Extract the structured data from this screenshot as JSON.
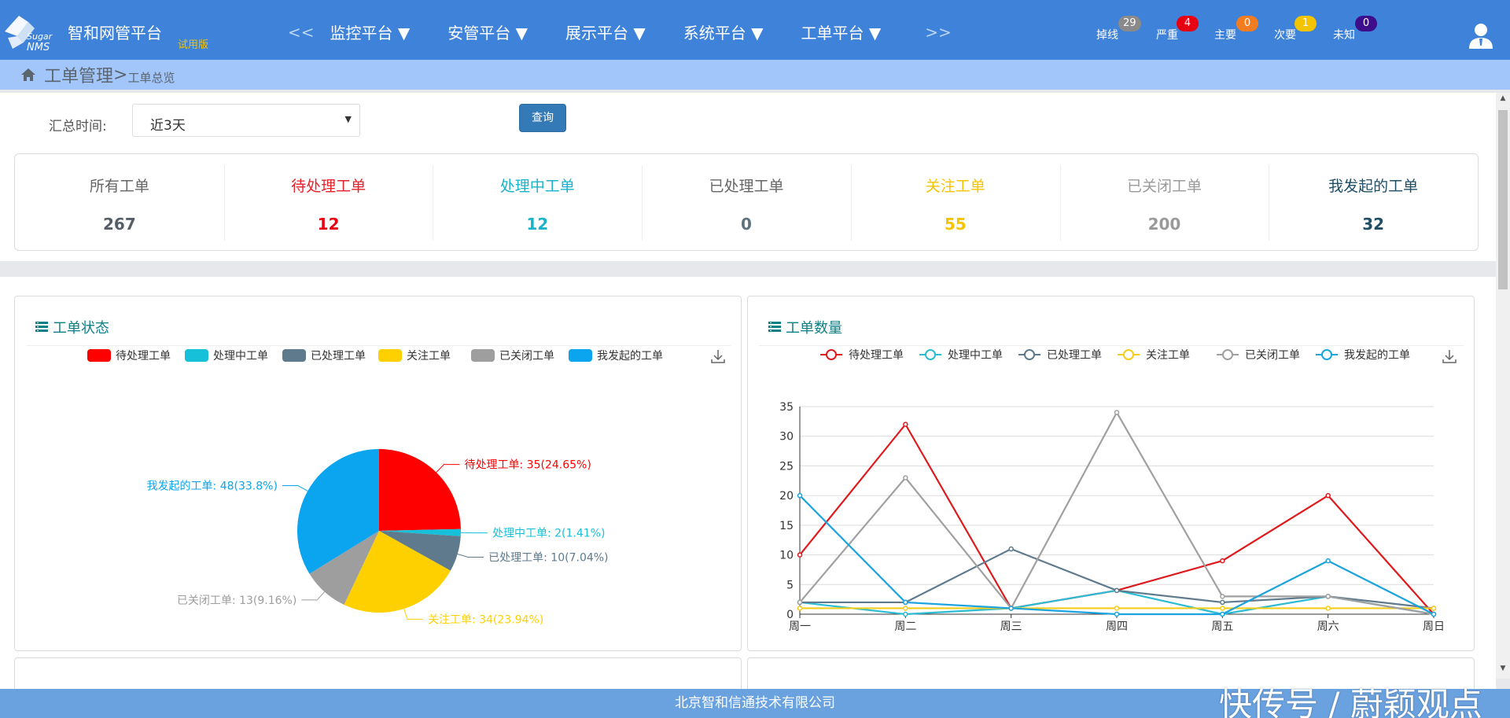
{
  "header": {
    "logo_text_1": "Sugar",
    "logo_text_2": "NMS",
    "app_title": "智和网管平台",
    "trial_badge": "试用版",
    "nav_prev": "<<",
    "nav_next": ">>",
    "nav_items": [
      "监控平台 ▼",
      "安管平台 ▼",
      "展示平台 ▼",
      "系统平台 ▼",
      "工单平台 ▼"
    ],
    "alarms": [
      {
        "label": "掉线",
        "count": "29",
        "color": "#8a8a8a"
      },
      {
        "label": "严重",
        "count": "4",
        "color": "#e60012"
      },
      {
        "label": "主要",
        "count": "0",
        "color": "#f47c20"
      },
      {
        "label": "次要",
        "count": "1",
        "color": "#f5c400"
      },
      {
        "label": "未知",
        "count": "0",
        "color": "#3d0d8c"
      }
    ],
    "user_icon": "user-icon"
  },
  "breadcrumb": {
    "home_icon": "home-icon",
    "main": "工单管理",
    "sep": ">",
    "sub": "工单总览"
  },
  "filter": {
    "label": "汇总时间:",
    "selected": "近3天",
    "query_button": "查询"
  },
  "stats": [
    {
      "label": "所有工单",
      "value": "267",
      "label_color": "#666666",
      "value_color": "#555e66"
    },
    {
      "label": "待处理工单",
      "value": "12",
      "label_color": "#e62129",
      "value_color": "#e60012"
    },
    {
      "label": "处理中工单",
      "value": "12",
      "label_color": "#19b4cc",
      "value_color": "#19b4cc"
    },
    {
      "label": "已处理工单",
      "value": "0",
      "label_color": "#666666",
      "value_color": "#5f7280"
    },
    {
      "label": "关注工单",
      "value": "55",
      "label_color": "#f5c400",
      "value_color": "#f5c400"
    },
    {
      "label": "已关闭工单",
      "value": "200",
      "label_color": "#9a9a9a",
      "value_color": "#9a9a9a"
    },
    {
      "label": "我发起的工单",
      "value": "32",
      "label_color": "#1f4e66",
      "value_color": "#1f4e66"
    }
  ],
  "cards": {
    "status_title": "工单状态",
    "count_title": "工单数量",
    "title_icon": "list-icon",
    "download_icon": "download-icon"
  },
  "chart_data": [
    {
      "type": "pie",
      "legend": [
        "待处理工单",
        "处理中工单",
        "已处理工单",
        "关注工单",
        "已关闭工单",
        "我发起的工单"
      ],
      "colors": [
        "#ff0000",
        "#16c0d8",
        "#5f7a8c",
        "#ffd000",
        "#9e9e9e",
        "#0aa5ee"
      ],
      "values": [
        35,
        2,
        10,
        34,
        13,
        48
      ],
      "labels": [
        "待处理工单: 35(24.65%)",
        "处理中工单: 2(1.41%)",
        "已处理工单: 10(7.04%)",
        "关注工单: 34(23.94%)",
        "已关闭工单: 13(9.16%)",
        "我发起的工单: 48(33.8%)"
      ],
      "legend_position": "top"
    },
    {
      "type": "line",
      "categories": [
        "周一",
        "周二",
        "周三",
        "周四",
        "周五",
        "周六",
        "周日"
      ],
      "ylim": [
        0,
        35
      ],
      "yticks": [
        "0",
        "5",
        "10",
        "15",
        "20",
        "25",
        "30",
        "35"
      ],
      "legend_position": "top",
      "series": [
        {
          "name": "待处理工单",
          "color": "#e0191c",
          "values": [
            10,
            32,
            1,
            4,
            9,
            20,
            0
          ]
        },
        {
          "name": "处理中工单",
          "color": "#2bbcd4",
          "values": [
            2,
            0,
            1,
            4,
            0,
            3,
            0
          ]
        },
        {
          "name": "已处理工单",
          "color": "#5f7a8c",
          "values": [
            2,
            2,
            11,
            4,
            2,
            3,
            1
          ]
        },
        {
          "name": "关注工单",
          "color": "#f4cc1b",
          "values": [
            1,
            1,
            1,
            1,
            1,
            1,
            1
          ]
        },
        {
          "name": "已关闭工单",
          "color": "#a0a0a0",
          "values": [
            2,
            23,
            1,
            34,
            3,
            3,
            0
          ]
        },
        {
          "name": "我发起的工单",
          "color": "#1aa3de",
          "values": [
            20,
            2,
            1,
            0,
            0,
            9,
            0
          ]
        }
      ]
    }
  ],
  "footer": {
    "company": "北京智和信通技术有限公司",
    "watermark": "快传号 / 蔚颖观点"
  }
}
